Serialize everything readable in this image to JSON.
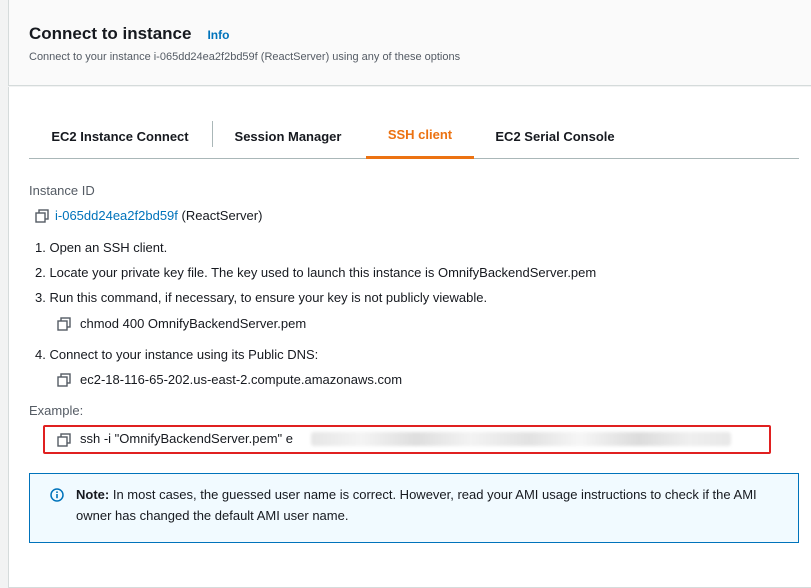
{
  "header": {
    "title": "Connect to instance",
    "info_label": "Info",
    "subtitle": "Connect to your instance i-065dd24ea2f2bd59f (ReactServer) using any of these options"
  },
  "tabs": [
    {
      "label": "EC2 Instance Connect",
      "active": false
    },
    {
      "label": "Session Manager",
      "active": false
    },
    {
      "label": "SSH client",
      "active": true
    },
    {
      "label": "EC2 Serial Console",
      "active": false
    }
  ],
  "instance": {
    "label": "Instance ID",
    "id": "i-065dd24ea2f2bd59f",
    "name": "(ReactServer)"
  },
  "steps": [
    "1. Open an SSH client.",
    "2. Locate your private key file. The key used to launch this instance is OmnifyBackendServer.pem",
    "3. Run this command, if necessary, to ensure your key is not publicly viewable.",
    "4. Connect to your instance using its Public DNS:"
  ],
  "chmod_command": "chmod 400 OmnifyBackendServer.pem",
  "public_dns": "ec2-18-116-65-202.us-east-2.compute.amazonaws.com",
  "example": {
    "label": "Example:",
    "command": "ssh -i \"OmnifyBackendServer.pem\" e"
  },
  "note": {
    "strong": "Note:",
    "text": " In most cases, the guessed user name is correct. However, read your AMI usage instructions to check if the AMI owner has changed the default AMI user name."
  },
  "colors": {
    "accent": "#ec7211",
    "link": "#0073bb",
    "highlight_border": "#e02020",
    "note_bg": "#f1faff"
  },
  "icons": {
    "copy": "copy-icon",
    "info": "info-circle-icon"
  }
}
